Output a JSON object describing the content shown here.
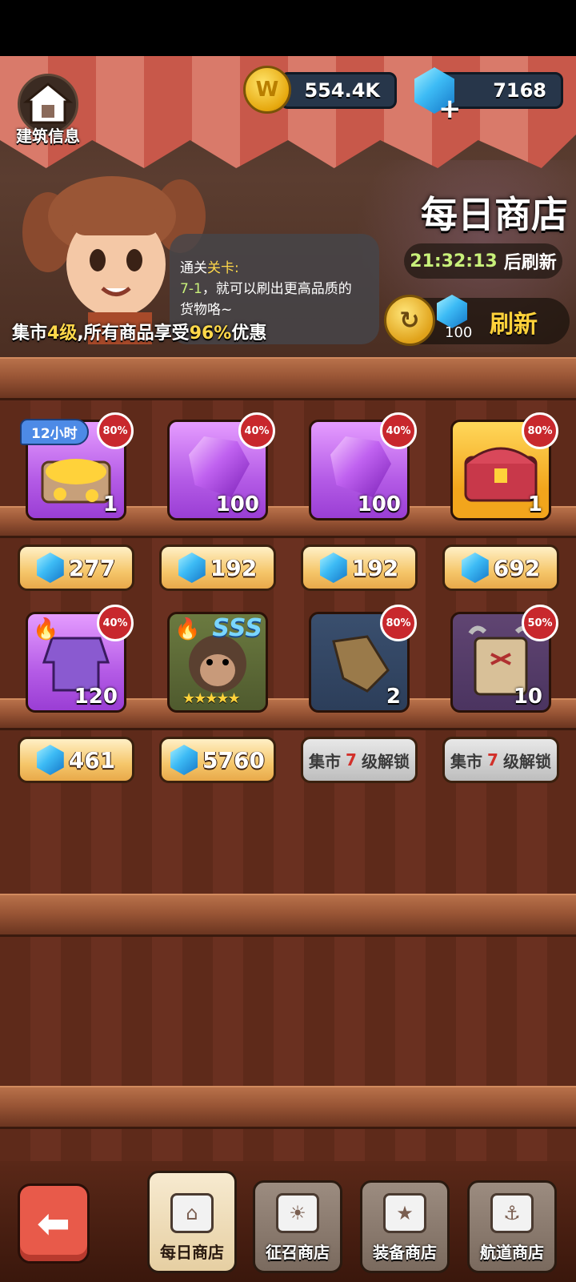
{
  "header": {
    "building_info_label": "建筑信息",
    "coins": "554.4K",
    "gems": "7168",
    "shop_title": "每日商店",
    "timer": "21:32:13",
    "timer_suffix": "后刷新",
    "refresh_label": "刷新",
    "refresh_cost": "100",
    "bubble": {
      "line1_prefix": "通关",
      "line1_highlight": "关卡:",
      "line2_highlight": "7-1",
      "line2_rest": "，就可以刷出更高品质的",
      "line3": "货物咯~"
    },
    "discount": {
      "prefix": "集市",
      "level": "4级",
      "middle": ",所有商品享受",
      "percent": "96%",
      "suffix": "优惠"
    }
  },
  "items_row1": [
    {
      "name": "gold-chest",
      "qty": "1",
      "badge": "80%",
      "tag": "12小时",
      "price": "277"
    },
    {
      "name": "purple-gem",
      "qty": "100",
      "badge": "40%",
      "price": "192"
    },
    {
      "name": "purple-gem",
      "qty": "100",
      "badge": "40%",
      "price": "192"
    },
    {
      "name": "red-chest",
      "qty": "1",
      "badge": "80%",
      "price": "692"
    }
  ],
  "items_row2": [
    {
      "name": "armor-fragment",
      "qty": "120",
      "badge": "40%",
      "price": "461"
    },
    {
      "name": "hero-monkey",
      "rank": "SSS",
      "stars": "★★★★★",
      "price": "5760"
    },
    {
      "name": "gauntlet",
      "qty": "2",
      "badge": "80%",
      "locked": "集市7级解锁",
      "lock_prefix": "集市",
      "lock_num": "7",
      "lock_suffix": "级解锁"
    },
    {
      "name": "map-scroll",
      "qty": "10",
      "badge": "50%",
      "locked": "集市7级解锁",
      "lock_prefix": "集市",
      "lock_num": "7",
      "lock_suffix": "级解锁"
    }
  ],
  "nav": {
    "tabs": [
      "每日商店",
      "征召商店",
      "装备商店",
      "航道商店"
    ]
  },
  "colors": {
    "accent_yellow": "#ffd23a",
    "discount_red": "#c8282d",
    "gem_blue": "#3dbbf5"
  }
}
